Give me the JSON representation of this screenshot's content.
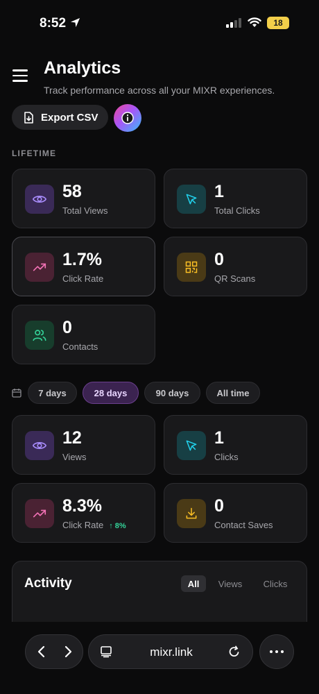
{
  "status_bar": {
    "time": "8:52",
    "battery": "18"
  },
  "header": {
    "title": "Analytics",
    "subtitle": "Track performance across all your MIXR experiences."
  },
  "actions": {
    "export_label": "Export CSV"
  },
  "lifetime": {
    "label": "LIFETIME",
    "cards": [
      {
        "value": "58",
        "label": "Total Views",
        "icon": "eye-icon"
      },
      {
        "value": "1",
        "label": "Total Clicks",
        "icon": "cursor-icon"
      },
      {
        "value": "1.7%",
        "label": "Click Rate",
        "icon": "trend-up-icon"
      },
      {
        "value": "0",
        "label": "QR Scans",
        "icon": "qr-code-icon"
      },
      {
        "value": "0",
        "label": "Contacts",
        "icon": "users-icon"
      }
    ]
  },
  "range": {
    "options": [
      "7 days",
      "28 days",
      "90 days",
      "All time"
    ],
    "selected": "28 days"
  },
  "period": {
    "cards": [
      {
        "value": "12",
        "label": "Views",
        "icon": "eye-icon"
      },
      {
        "value": "1",
        "label": "Clicks",
        "icon": "cursor-icon"
      },
      {
        "value": "8.3%",
        "label": "Click Rate",
        "delta": "↑ 8%",
        "icon": "trend-up-icon"
      },
      {
        "value": "0",
        "label": "Contact Saves",
        "icon": "download-icon"
      }
    ]
  },
  "activity": {
    "title": "Activity",
    "tabs": [
      "All",
      "Views",
      "Clicks"
    ],
    "selected_tab": "All"
  },
  "browser": {
    "url": "mixr.link"
  },
  "colors": {
    "background": "#0b0b0c",
    "card": "#19191b",
    "accent_purple": "#a78bfa",
    "accent_teal": "#22d3ee",
    "accent_pink": "#f472b6",
    "accent_amber": "#fbbf24",
    "accent_green": "#34d399"
  }
}
